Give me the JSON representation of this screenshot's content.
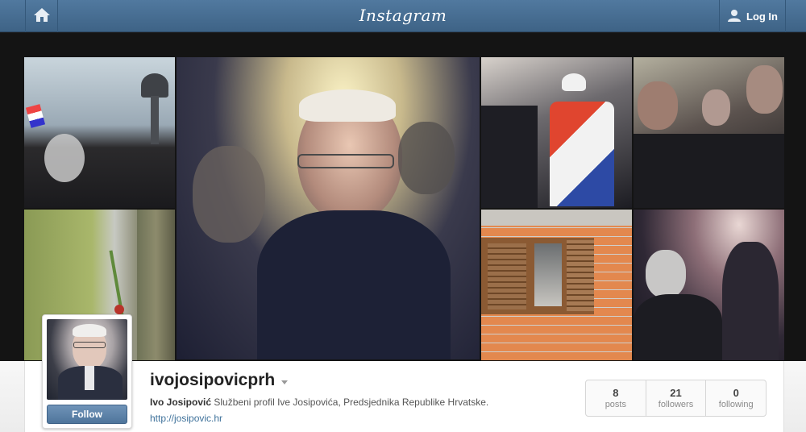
{
  "header": {
    "logo_text": "Instagram",
    "home_icon": "home-icon",
    "login_label": "Log In",
    "user_icon": "user-icon"
  },
  "photos": [
    {
      "alt": "crowd with flag and water tower"
    },
    {
      "alt": "smiling man with glasses"
    },
    {
      "alt": "crowd with croatian flag"
    },
    {
      "alt": "men in dark coats"
    },
    {
      "alt": "soldier holding rose"
    },
    {
      "alt": "brick wall with window"
    },
    {
      "alt": "crowd backlit"
    }
  ],
  "profile": {
    "username": "ivojosipovicprh",
    "full_name": "Ivo Josipović",
    "bio": "Službeni profil Ive Josipovića, Predsjednika Republike Hrvatske.",
    "website": "http://josipovic.hr",
    "follow_label": "Follow"
  },
  "stats": [
    {
      "value": "8",
      "label": "posts"
    },
    {
      "value": "21",
      "label": "followers"
    },
    {
      "value": "0",
      "label": "following"
    }
  ],
  "colors": {
    "header_bg": "#4a7099",
    "follow_button": "#5a80a6",
    "link": "#3f729b"
  }
}
